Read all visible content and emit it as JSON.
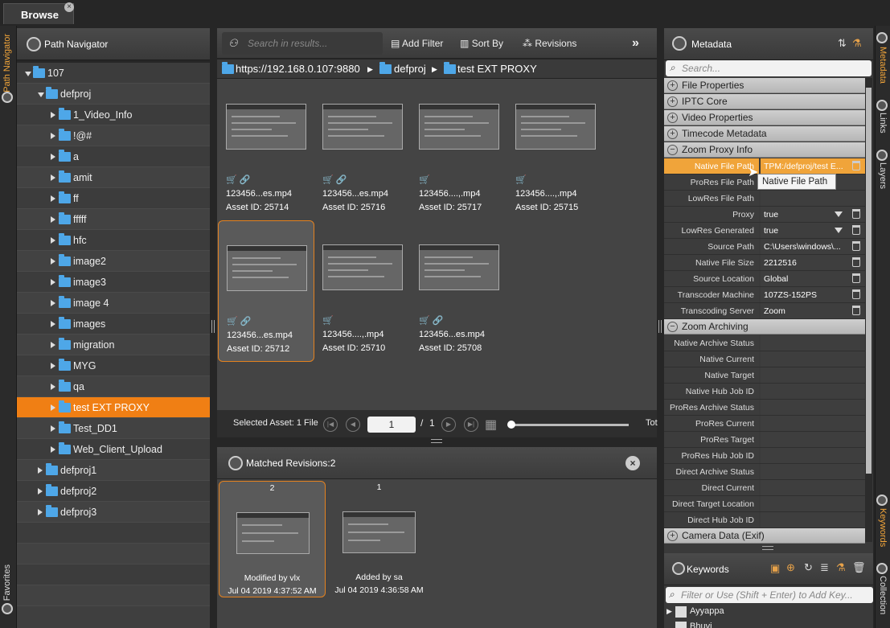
{
  "tab": {
    "label": "Browse"
  },
  "left_sidebar": {
    "path_navigator": "Path Navigator",
    "favorites": "Favorites"
  },
  "path_navigator": {
    "title": "Path Navigator"
  },
  "tree": [
    {
      "label": "107",
      "level": 0,
      "expanded": true,
      "selected": false
    },
    {
      "label": "defproj",
      "level": 1,
      "expanded": true,
      "selected": false
    },
    {
      "label": "1_Video_Info",
      "level": 2,
      "expanded": false,
      "selected": false
    },
    {
      "label": "!@#",
      "level": 2,
      "expanded": false,
      "selected": false
    },
    {
      "label": "a",
      "level": 2,
      "expanded": false,
      "selected": false
    },
    {
      "label": "amit",
      "level": 2,
      "expanded": false,
      "selected": false
    },
    {
      "label": "ff",
      "level": 2,
      "expanded": false,
      "selected": false
    },
    {
      "label": "fffff",
      "level": 2,
      "expanded": false,
      "selected": false
    },
    {
      "label": "hfc",
      "level": 2,
      "expanded": false,
      "selected": false
    },
    {
      "label": "image2",
      "level": 2,
      "expanded": false,
      "selected": false
    },
    {
      "label": "image3",
      "level": 2,
      "expanded": false,
      "selected": false
    },
    {
      "label": "image 4",
      "level": 2,
      "expanded": false,
      "selected": false
    },
    {
      "label": "images",
      "level": 2,
      "expanded": false,
      "selected": false
    },
    {
      "label": "migration",
      "level": 2,
      "expanded": false,
      "selected": false
    },
    {
      "label": "MYG",
      "level": 2,
      "expanded": false,
      "selected": false
    },
    {
      "label": "qa",
      "level": 2,
      "expanded": false,
      "selected": false
    },
    {
      "label": "test EXT PROXY",
      "level": 2,
      "expanded": false,
      "selected": true
    },
    {
      "label": "Test_DD1",
      "level": 2,
      "expanded": false,
      "selected": false
    },
    {
      "label": "Web_Client_Upload",
      "level": 2,
      "expanded": false,
      "selected": false
    },
    {
      "label": "defproj1",
      "level": 1,
      "expanded": false,
      "selected": false
    },
    {
      "label": "defproj2",
      "level": 1,
      "expanded": false,
      "selected": false
    },
    {
      "label": "defproj3",
      "level": 1,
      "expanded": false,
      "selected": false
    }
  ],
  "toolbar": {
    "search_placeholder": "Search in results...",
    "add_filter": "Add Filter",
    "sort_by": "Sort By",
    "revisions": "Revisions",
    "more": "»"
  },
  "breadcrumb": [
    "https://192.168.0.107:9880",
    "defproj",
    "test EXT PROXY"
  ],
  "assets": [
    {
      "name": "123456...es.mp4",
      "id": "Asset ID: 25714",
      "cart": true,
      "link": true,
      "selected": false
    },
    {
      "name": "123456...es.mp4",
      "id": "Asset ID: 25716",
      "cart": true,
      "link": true,
      "selected": false
    },
    {
      "name": "123456....,.mp4",
      "id": "Asset ID: 25717",
      "cart": true,
      "link": false,
      "selected": false
    },
    {
      "name": "123456....,.mp4",
      "id": "Asset ID: 25715",
      "cart": true,
      "link": false,
      "selected": false
    },
    {
      "name": "123456...es.mp4",
      "id": "Asset ID: 25712",
      "cart": true,
      "link": true,
      "selected": true
    },
    {
      "name": "123456....,.mp4",
      "id": "Asset ID: 25710",
      "cart": true,
      "link": false,
      "selected": false
    },
    {
      "name": "123456...es.mp4",
      "id": "Asset ID: 25708",
      "cart": true,
      "link": true,
      "selected": false
    }
  ],
  "pager": {
    "selected": "Selected Asset: 1 File",
    "page": "1",
    "of": "/",
    "total": "1",
    "tot": "Tot"
  },
  "revisions": {
    "title": "Matched Revisions:2",
    "items": [
      {
        "number": "2",
        "desc": "Modified by vlx",
        "date": "Jul 04 2019 4:37:52 AM",
        "selected": true
      },
      {
        "number": "1",
        "desc": "Added by sa",
        "date": "Jul 04 2019 4:36:58 AM",
        "selected": false
      }
    ]
  },
  "metadata": {
    "title": "Metadata",
    "search_placeholder": "Search...",
    "sections_top": [
      "File Properties",
      "IPTC Core",
      "Video Properties",
      "Timecode Metadata",
      "Zoom Proxy Info"
    ],
    "proxy_rows": [
      {
        "key": "Native File Path",
        "value": "TPM:/defproj/test E...",
        "dropdown": false,
        "trash": true,
        "highlight": true
      },
      {
        "key": "ProRes File Path",
        "value": "",
        "dropdown": false,
        "trash": false,
        "highlight": false
      },
      {
        "key": "LowRes File Path",
        "value": "",
        "dropdown": false,
        "trash": false,
        "highlight": false
      },
      {
        "key": "Proxy",
        "value": "true",
        "dropdown": true,
        "trash": true,
        "highlight": false
      },
      {
        "key": "LowRes Generated",
        "value": "true",
        "dropdown": true,
        "trash": true,
        "highlight": false
      },
      {
        "key": "Source Path",
        "value": "C:\\Users\\windows\\...",
        "dropdown": false,
        "trash": true,
        "highlight": false
      },
      {
        "key": "Native File Size",
        "value": "2212516",
        "dropdown": false,
        "trash": true,
        "highlight": false
      },
      {
        "key": "Source Location",
        "value": "Global",
        "dropdown": false,
        "trash": true,
        "highlight": false
      },
      {
        "key": "Transcoder Machine",
        "value": "107ZS-152PS",
        "dropdown": false,
        "trash": true,
        "highlight": false
      },
      {
        "key": "Transcoding Server",
        "value": "Zoom",
        "dropdown": false,
        "trash": true,
        "highlight": false
      }
    ],
    "archiving_section": "Zoom Archiving",
    "archiving_rows": [
      "Native Archive Status",
      "Native Current",
      "Native Target",
      "Native Hub Job ID",
      "ProRes Archive Status",
      "ProRes Current",
      "ProRes Target",
      "ProRes Hub Job ID",
      "Direct Archive Status",
      "Direct Current",
      "Direct Target Location",
      "Direct Hub Job ID"
    ],
    "last_section": "Camera Data (Exif)",
    "tooltip": "Native File Path"
  },
  "keywords": {
    "title": "Keywords",
    "placeholder": "Filter or Use (Shift + Enter) to Add Key...",
    "items": [
      "Ayyappa",
      "Bhuvi"
    ]
  },
  "right_sidebar": {
    "metadata": "Metadata",
    "links": "Links",
    "layers": "Layers",
    "keywords": "Keywords",
    "collection": "Collection"
  }
}
